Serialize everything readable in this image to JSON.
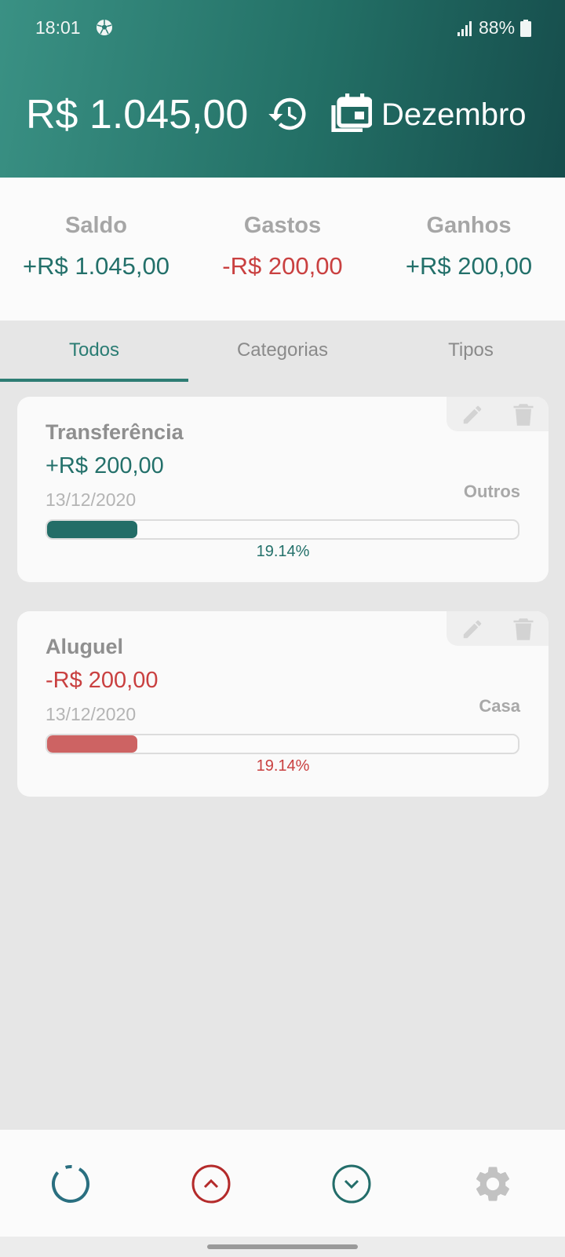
{
  "status_bar": {
    "time": "18:01",
    "battery": "88%",
    "icons": [
      "soccer-ball-icon",
      "signal-icon",
      "battery-icon"
    ]
  },
  "header": {
    "balance": "R$ 1.045,00",
    "month": "Dezembro",
    "icons": [
      "history-icon",
      "calendar-icon"
    ]
  },
  "summary": {
    "saldo_label": "Saldo",
    "saldo_value": "+R$ 1.045,00",
    "gastos_label": "Gastos",
    "gastos_value": "-R$ 200,00",
    "ganhos_label": "Ganhos",
    "ganhos_value": "+R$ 200,00"
  },
  "tabs": [
    {
      "label": "Todos",
      "selected": true
    },
    {
      "label": "Categorias",
      "selected": false
    },
    {
      "label": "Tipos",
      "selected": false
    }
  ],
  "transactions": [
    {
      "title": "Transferência",
      "amount": "+R$ 200,00",
      "date": "13/12/2020",
      "category": "Outros",
      "percent_label": "19.14%",
      "percent": 19.14,
      "kind": "income"
    },
    {
      "title": "Aluguel",
      "amount": "-R$ 200,00",
      "date": "13/12/2020",
      "category": "Casa",
      "percent_label": "19.14%",
      "percent": 19.14,
      "kind": "expense"
    }
  ],
  "bottom_nav": [
    "overview-icon",
    "income-icon",
    "expense-icon",
    "settings-icon"
  ],
  "colors": {
    "accent": "#2e7d74",
    "positive": "#23706a",
    "negative": "#c94040"
  }
}
